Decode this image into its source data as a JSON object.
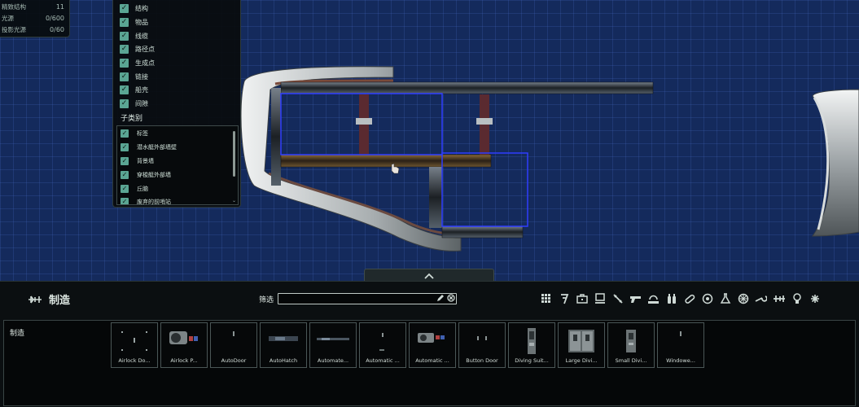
{
  "stats": [
    {
      "label": "精致结构",
      "value": "11"
    },
    {
      "label": "光源",
      "value": "0/600"
    },
    {
      "label": "投影光源",
      "value": "0/60"
    }
  ],
  "layers": {
    "items": [
      "结构",
      "物品",
      "线缆",
      "路径点",
      "生成点",
      "链接",
      "船壳",
      "间隙"
    ],
    "subcategory_title": "子类别",
    "subitems": [
      "标签",
      "潜水艇外部墙壁",
      "背景墙",
      "穿梭艇外部墙",
      "丘脑",
      "废弃的前哨站"
    ]
  },
  "toolbar": {
    "title": "制造",
    "filter_label": "筛选",
    "filter_value": "",
    "category_icons": [
      "grid-icon",
      "hook-icon",
      "briefcase-icon",
      "monitor-icon",
      "syringe-icon",
      "gun-icon",
      "diving-helmet-icon",
      "bottles-icon",
      "capsule-icon",
      "target-icon",
      "flask-icon",
      "wheel-icon",
      "wrench-icon",
      "fabricator-icon",
      "bulb-icon",
      "star-icon"
    ]
  },
  "list": {
    "label": "制造",
    "items": [
      "Airlock Do...",
      "Airlock P...",
      "AutoDoor",
      "AutoHatch",
      "Automate...",
      "Automatic ...",
      "Automatic ...",
      "Button Door",
      "Diving Suit...",
      "Large Divi...",
      "Small Divi...",
      "Windowe..."
    ]
  }
}
